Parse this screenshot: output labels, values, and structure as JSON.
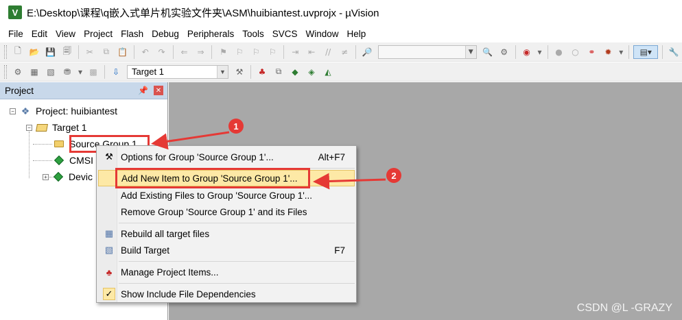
{
  "window": {
    "title": "E:\\Desktop\\课程\\q嵌入式单片机实验文件夹\\ASM\\huibiantest.uvprojx - µVision",
    "icon": "µVision-logo-icon"
  },
  "menubar": [
    "File",
    "Edit",
    "View",
    "Project",
    "Flash",
    "Debug",
    "Peripherals",
    "Tools",
    "SVCS",
    "Window",
    "Help"
  ],
  "toolbar": {
    "target_combo_value": "Target 1"
  },
  "project_panel": {
    "title": "Project",
    "tree": {
      "project": "Project: huibiantest",
      "target": "Target 1",
      "group": "Source Group 1",
      "cmsis": "CMSI",
      "device": "Devic"
    }
  },
  "context_menu": {
    "items": [
      {
        "label": "Options for Group 'Source Group 1'...",
        "shortcut": "Alt+F7"
      },
      {
        "label": "Add New  Item to Group 'Source Group 1'...",
        "shortcut": ""
      },
      {
        "label": "Add Existing Files to Group 'Source Group 1'...",
        "shortcut": ""
      },
      {
        "label": "Remove Group 'Source Group 1' and its Files",
        "shortcut": ""
      },
      {
        "label": "Rebuild all target files",
        "shortcut": ""
      },
      {
        "label": "Build Target",
        "shortcut": "F7"
      },
      {
        "label": "Manage Project Items...",
        "shortcut": ""
      },
      {
        "label": "Show Include File Dependencies",
        "shortcut": ""
      }
    ]
  },
  "annotations": {
    "badge1": "1",
    "badge2": "2",
    "color": "#e53935"
  },
  "watermark": "CSDN @L -GRAZY"
}
